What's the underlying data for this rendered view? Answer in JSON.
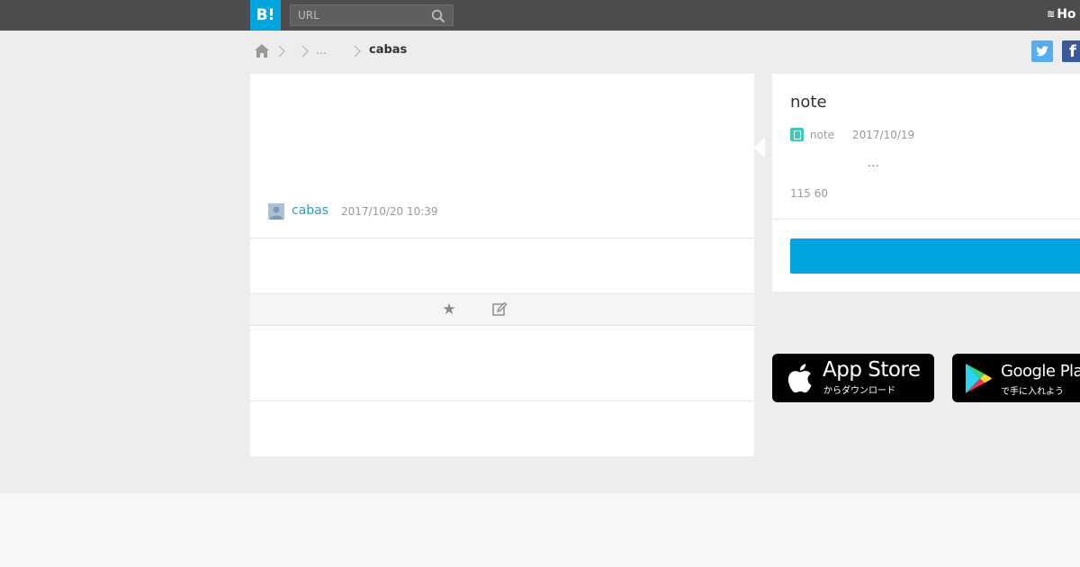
{
  "header": {
    "logo": "B!",
    "search_placeholder": "URL",
    "right_brand": "Ho"
  },
  "breadcrumb": {
    "ellipsis": "…",
    "current": "cabas"
  },
  "bookmark": {
    "user": "cabas",
    "date": "2017/10/20 10:39"
  },
  "entry": {
    "title": "note",
    "site": "note",
    "date": "2017/10/19",
    "description": "…",
    "counts": "115 60"
  },
  "badges": {
    "appstore": {
      "title": "App Store",
      "subtitle": "からダウンロード"
    },
    "google": {
      "title": "Google Play",
      "subtitle": "で手に入れよう"
    }
  },
  "colors": {
    "brand": "#00a4de",
    "topbar": "#4d4d4d",
    "link": "#2a9bc7",
    "favicon": "#41c9b4"
  },
  "icons": [
    "home-icon",
    "chevron-right-icon",
    "search-icon",
    "star-icon",
    "edit-icon",
    "twitter-icon",
    "facebook-icon",
    "apple-icon",
    "google-play-icon"
  ]
}
